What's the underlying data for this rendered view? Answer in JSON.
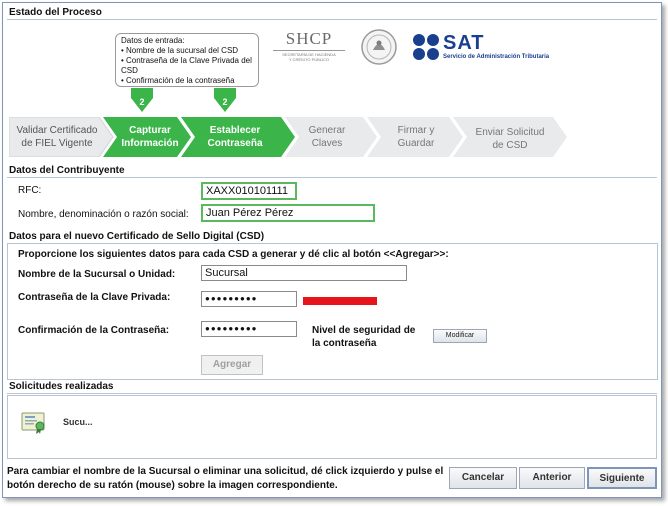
{
  "header": {
    "title": "Estado del Proceso"
  },
  "popup": {
    "title": "Datos de entrada:",
    "items": [
      "• Nombre de la sucursal del CSD",
      "• Contraseña de la Clave Privada del CSD",
      "• Confirmación de la contraseña"
    ]
  },
  "logos": {
    "shcp_name": "SHCP",
    "shcp_sub1": "SECRETARÍA DE HACIENDA",
    "shcp_sub2": "Y CRÉDITO PÚBLICO",
    "sat_name": "SAT",
    "sat_sub": "Servicio de Administración Tributaria"
  },
  "steps": [
    {
      "label": "Validar Certificado de FIEL Vigente",
      "active": false
    },
    {
      "label": "Capturar Información",
      "active": true,
      "marker": "2"
    },
    {
      "label": "Establecer Contraseña",
      "active": true,
      "marker": "2"
    },
    {
      "label": "Generar Claves",
      "active": false
    },
    {
      "label": "Firmar y Guardar",
      "active": false
    },
    {
      "label": "Enviar Solicitud de CSD",
      "active": false
    }
  ],
  "contribuyente": {
    "title": "Datos del Contribuyente",
    "rfc_label": "RFC:",
    "rfc_value": "XAXX010101111",
    "nombre_label": "Nombre, denominación o razón social:",
    "nombre_value": "Juan Pérez Pérez"
  },
  "csd": {
    "title": "Datos para el nuevo Certificado de Sello Digital (CSD)",
    "instructions": "Proporcione los siguientes datos para cada CSD a generar y dé clic al botón <<Agregar>>:",
    "sucursal_label": "Nombre de la Sucursal o Unidad:",
    "sucursal_value": "Sucursal",
    "pass_label": "Contraseña de la Clave Privada:",
    "pass_value": "●●●●●●●●●",
    "confirm_label": "Confirmación de la Contraseña:",
    "confirm_value": "●●●●●●●●●",
    "security_label": "Nivel de seguridad de la contraseña",
    "security_color": "#e8141b",
    "modify_button": "Modificar",
    "add_button": "Agregar"
  },
  "solicitudes": {
    "title": "Solicitudes realizadas",
    "items": [
      {
        "label": "Sucu..."
      }
    ]
  },
  "footer": {
    "note": "Para cambiar el nombre de la Sucursal o eliminar una solicitud, dé click izquierdo y pulse el botón derecho de su ratón (mouse) sobre la imagen correspondiente.",
    "cancel": "Cancelar",
    "previous": "Anterior",
    "next": "Siguiente"
  },
  "colors": {
    "active_step": "#3bb54a",
    "inactive_step": "#e9eaeb",
    "border_blue": "#7d96b8",
    "sat_blue": "#1b3f8f"
  }
}
